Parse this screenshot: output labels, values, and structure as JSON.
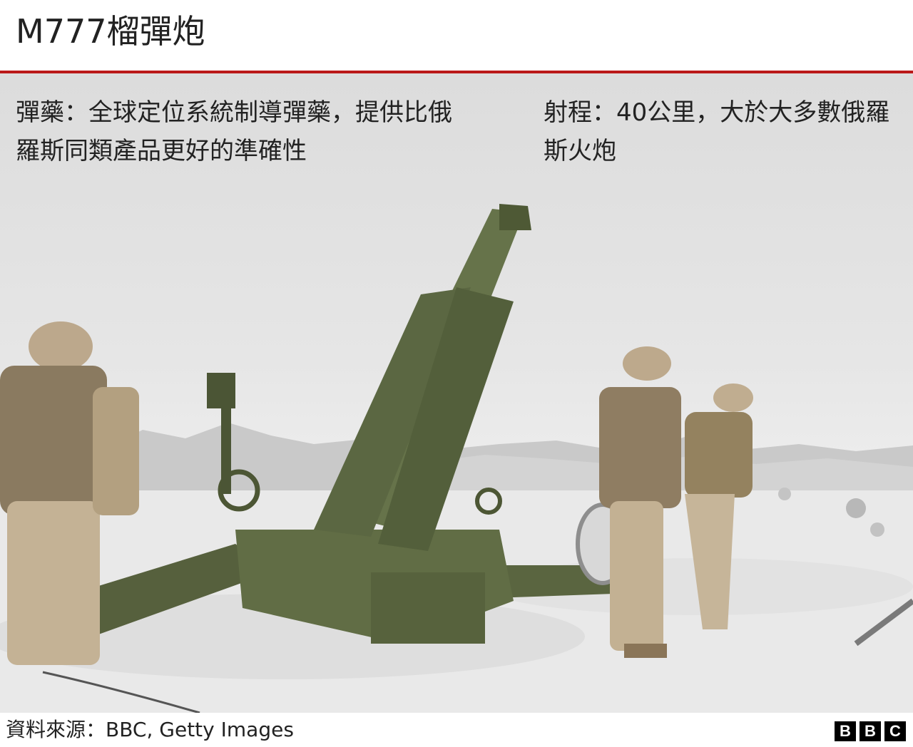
{
  "header": {
    "title": "M777榴彈炮"
  },
  "facts": {
    "ammunition": "彈藥：全球定位系統制導彈藥，提供比俄羅斯同類產品更好的準確性",
    "range": "射程：40公里，大於大多數俄羅斯火炮"
  },
  "footer": {
    "source": "資料來源：BBC, Getty Images",
    "logo_letters": [
      "B",
      "B",
      "C"
    ]
  },
  "colors": {
    "accent_rule": "#bb1919",
    "gun_green": "#5f6b44",
    "camo": "#b89f7e"
  }
}
